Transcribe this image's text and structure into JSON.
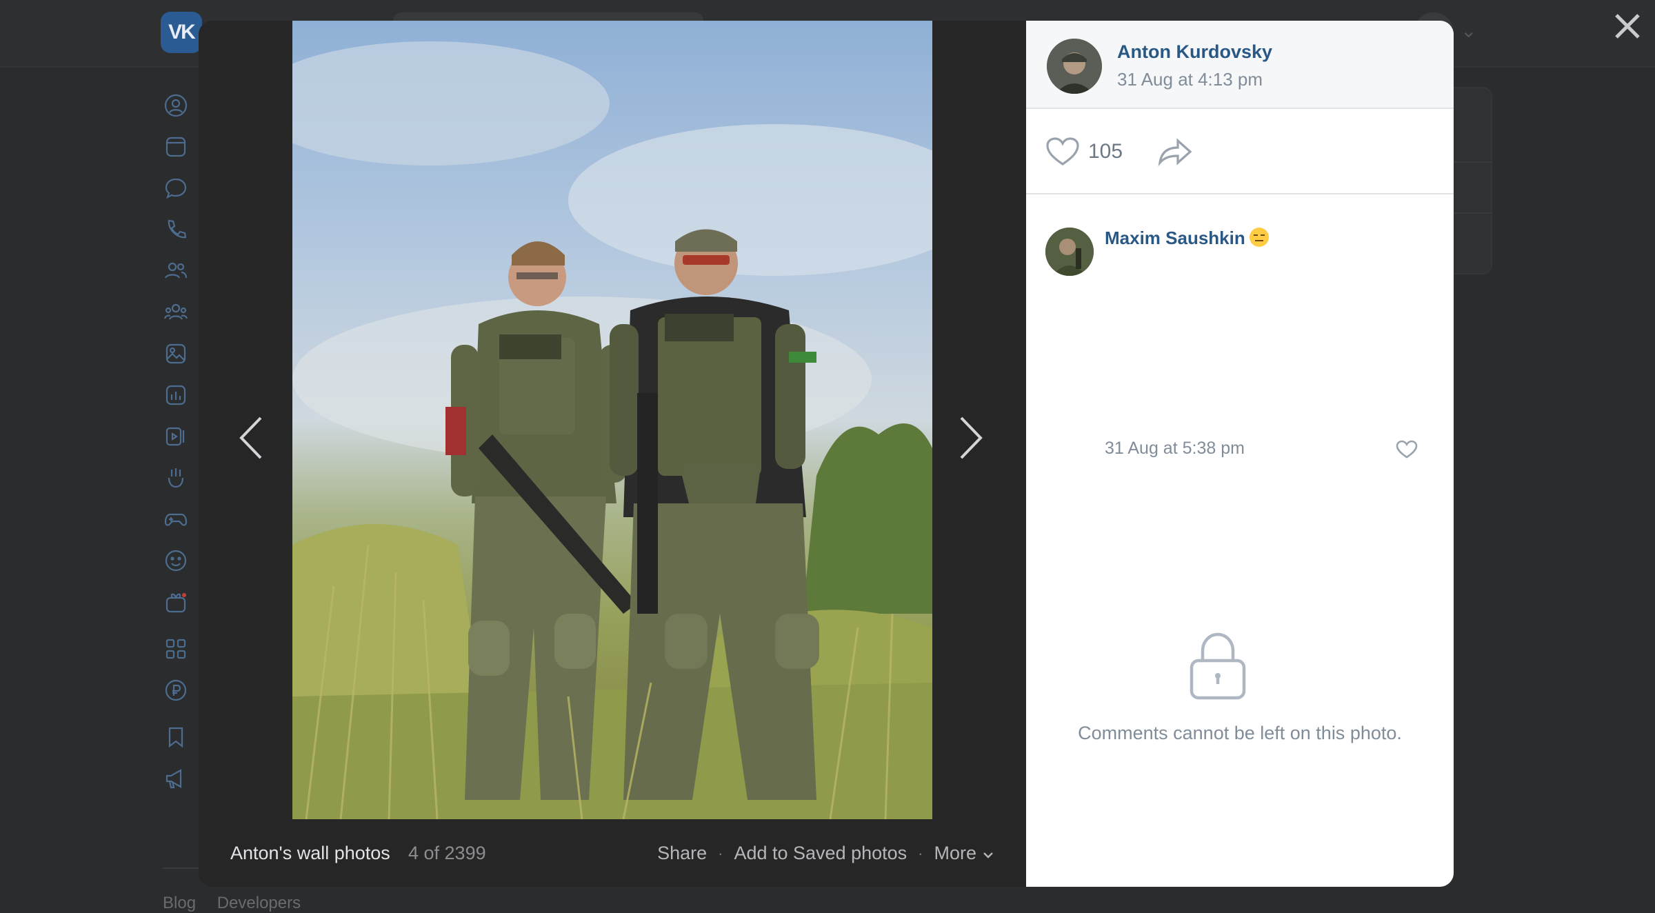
{
  "viewer": {
    "author_name": "Anton Kurdovsky",
    "post_date": "31 Aug at 4:13 pm",
    "likes": "105",
    "album_title": "Anton's wall photos",
    "counter": "4 of 2399",
    "actions": {
      "share": "Share",
      "save": "Add to Saved photos",
      "more": "More"
    },
    "comment": {
      "author": "Maxim Saushkin",
      "date": "31 Aug at 5:38 pm"
    },
    "comments_disabled_text": "Comments cannot be left on this photo."
  },
  "background_page": {
    "logo": "VK",
    "footer_links": [
      "Blog",
      "Developers"
    ],
    "nav_icons": [
      "profile-icon",
      "news-icon",
      "messages-icon",
      "calls-icon",
      "friends-icon",
      "communities-icon",
      "photos-icon",
      "music-icon",
      "videos-icon",
      "clips-icon",
      "games-icon",
      "stickers-icon",
      "gifts-icon",
      "apps-icon",
      "payments-icon",
      "bookmarks-icon",
      "ads-icon"
    ]
  },
  "colors": {
    "link": "#2a5885",
    "muted": "#818c99",
    "overlay": "#2b2c2e",
    "panel_bg": "#ffffff"
  }
}
